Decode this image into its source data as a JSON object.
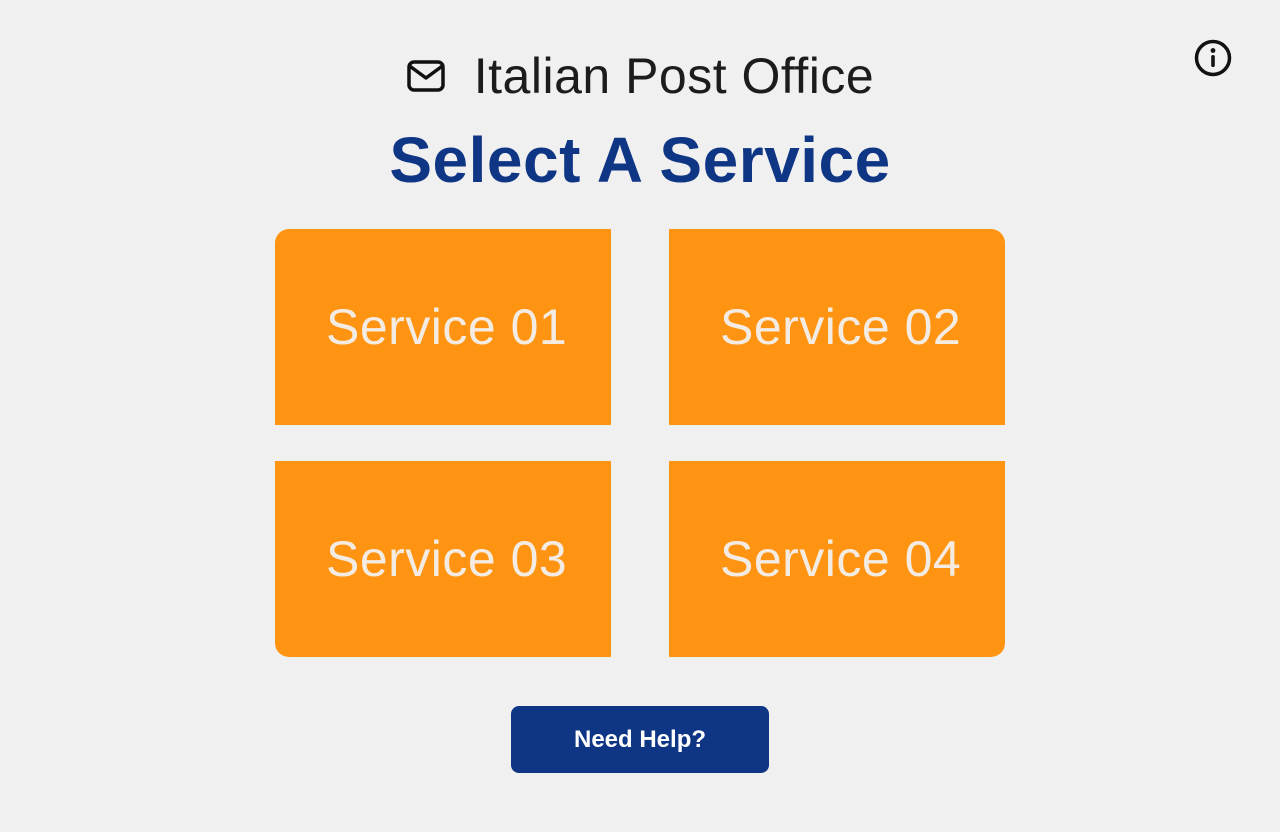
{
  "header": {
    "icon": "mail-icon",
    "title": "Italian Post Office",
    "info_icon": "info-circle-icon"
  },
  "main": {
    "title": "Select A Service",
    "services": [
      {
        "label": "Service 01"
      },
      {
        "label": "Service 02"
      },
      {
        "label": "Service 03"
      },
      {
        "label": "Service 04"
      }
    ],
    "help_button_label": "Need Help?"
  },
  "colors": {
    "background": "#f0f0f0",
    "primary": "#0f3585",
    "tile": "#ff9412",
    "tile_text": "#f4ece2",
    "title_text": "#1c1c1c"
  }
}
